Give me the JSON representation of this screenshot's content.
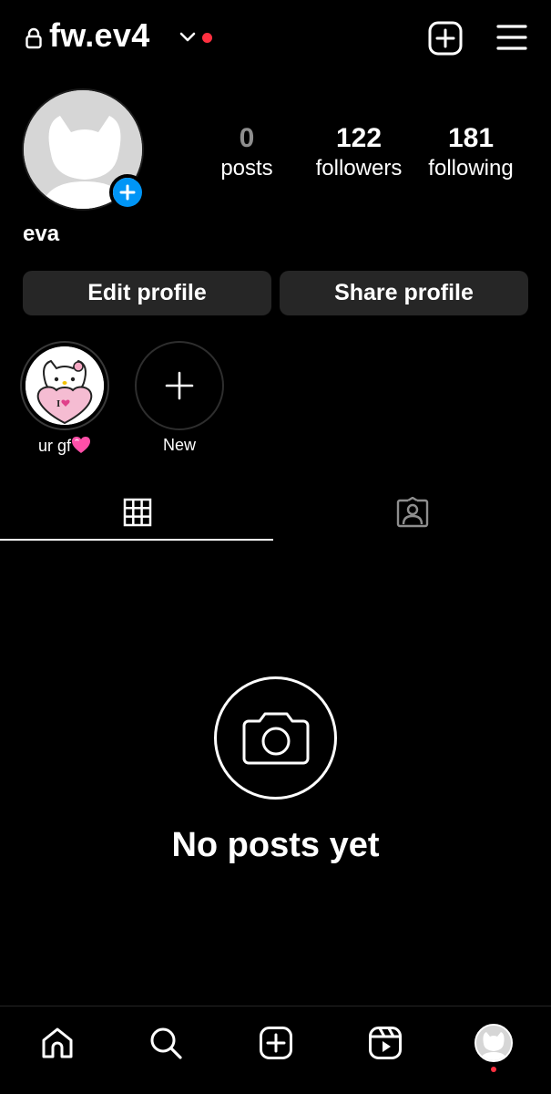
{
  "header": {
    "username": "fw.ev4",
    "icons": {
      "lock": "lock-icon",
      "chevron": "chevron-down-icon",
      "create": "plus-square-icon",
      "menu": "hamburger-menu-icon"
    },
    "notification_color": "#ff3040"
  },
  "profile": {
    "display_name": "eva",
    "stats": [
      {
        "value": "0",
        "label": "posts"
      },
      {
        "value": "122",
        "label": "followers"
      },
      {
        "value": "181",
        "label": "following"
      }
    ],
    "add_story_color": "#0095f6"
  },
  "buttons": {
    "edit_label": "Edit profile",
    "share_label": "Share profile"
  },
  "highlights": [
    {
      "label": "ur gf",
      "emoji": "pink-heart-emoji"
    },
    {
      "label": "New"
    }
  ],
  "highlight_badge_text": "I",
  "tabs": [
    {
      "name": "posts-grid",
      "icon": "grid-icon",
      "active": true
    },
    {
      "name": "tagged",
      "icon": "tagged-person-icon",
      "active": false
    }
  ],
  "empty_state": {
    "icon": "camera-icon",
    "text": "No posts yet"
  },
  "bottom_nav": [
    {
      "icon": "home-icon"
    },
    {
      "icon": "search-icon"
    },
    {
      "icon": "create-icon"
    },
    {
      "icon": "reels-icon"
    },
    {
      "icon": "profile-avatar"
    }
  ],
  "colors": {
    "background": "#000000",
    "button_bg": "#262626",
    "accent_blue": "#0095f6",
    "notification_red": "#ff3040",
    "muted_text": "#8e8e8e"
  }
}
